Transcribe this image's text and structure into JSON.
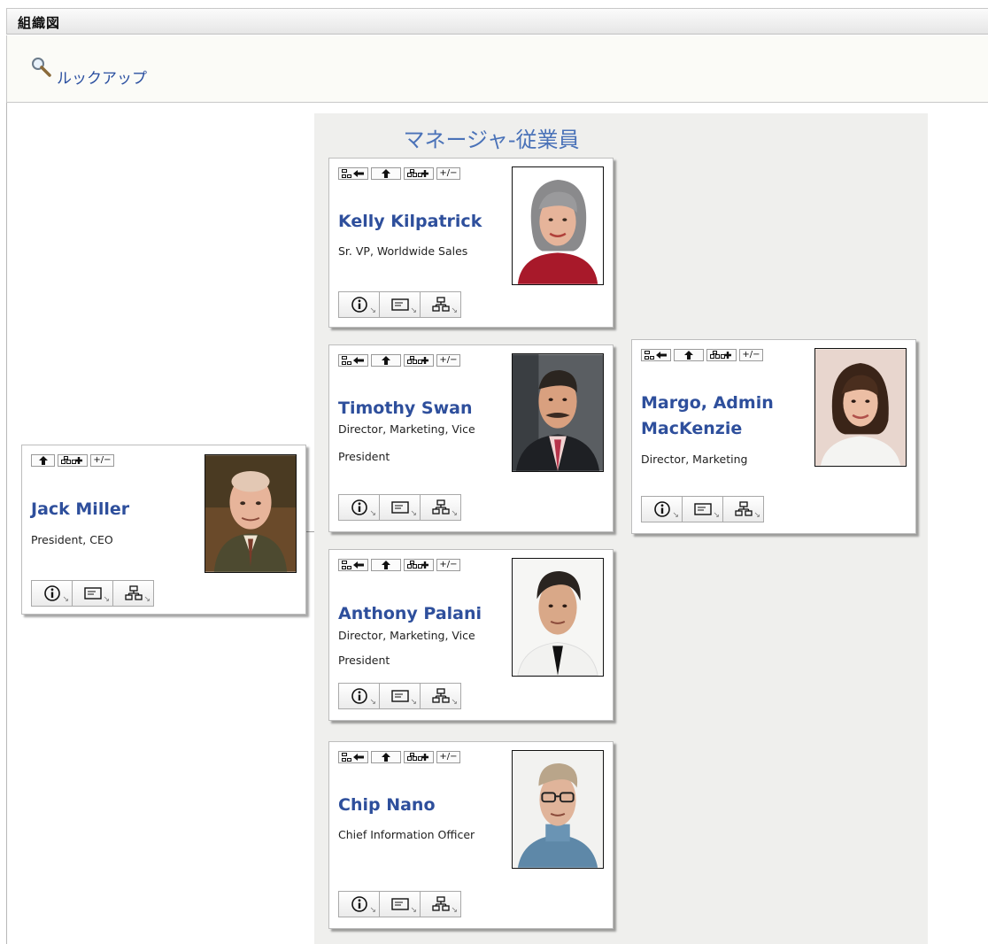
{
  "header": {
    "title": "組織図"
  },
  "lookup": {
    "label": "ルックアップ",
    "icon": "magnifier-icon"
  },
  "section": {
    "title": "マネージャ-従業員"
  },
  "colors": {
    "link": "#2e4f9c",
    "section_title": "#4a72b8",
    "section_bg": "#efefed"
  },
  "manager": {
    "name": "Jack Miller",
    "role_lines": [
      "President, CEO"
    ],
    "photo": "photo-jack-miller"
  },
  "employees": [
    {
      "name": "Kelly Kilpatrick",
      "role_lines": [
        "Sr. VP, Worldwide Sales"
      ],
      "photo": "photo-kelly-kilpatrick"
    },
    {
      "name": "Timothy Swan",
      "role_lines": [
        "Director, Marketing, Vice",
        "President"
      ],
      "photo": "photo-timothy-swan"
    },
    {
      "name": "Anthony Palani",
      "role_lines": [
        "Director, Marketing, Vice",
        "President"
      ],
      "photo": "photo-anthony-palani"
    },
    {
      "name": "Chip Nano",
      "role_lines": [
        "Chief Information Officer"
      ],
      "photo": "photo-chip-nano"
    }
  ],
  "reports": {
    "timothy_swan": [
      {
        "name_lines": [
          "Margo, Admin",
          "MacKenzie"
        ],
        "role_lines": [
          "Director, Marketing"
        ],
        "photo": "photo-margo-mackenzie"
      }
    ]
  },
  "card_toolbar": {
    "buttons": [
      "show-manager-icon",
      "up-level-icon",
      "expand-reports-icon",
      "toggle-expand-icon"
    ],
    "toggle_label": "+/−"
  },
  "card_actions": [
    "info-icon",
    "vcard-icon",
    "orgchart-icon"
  ]
}
